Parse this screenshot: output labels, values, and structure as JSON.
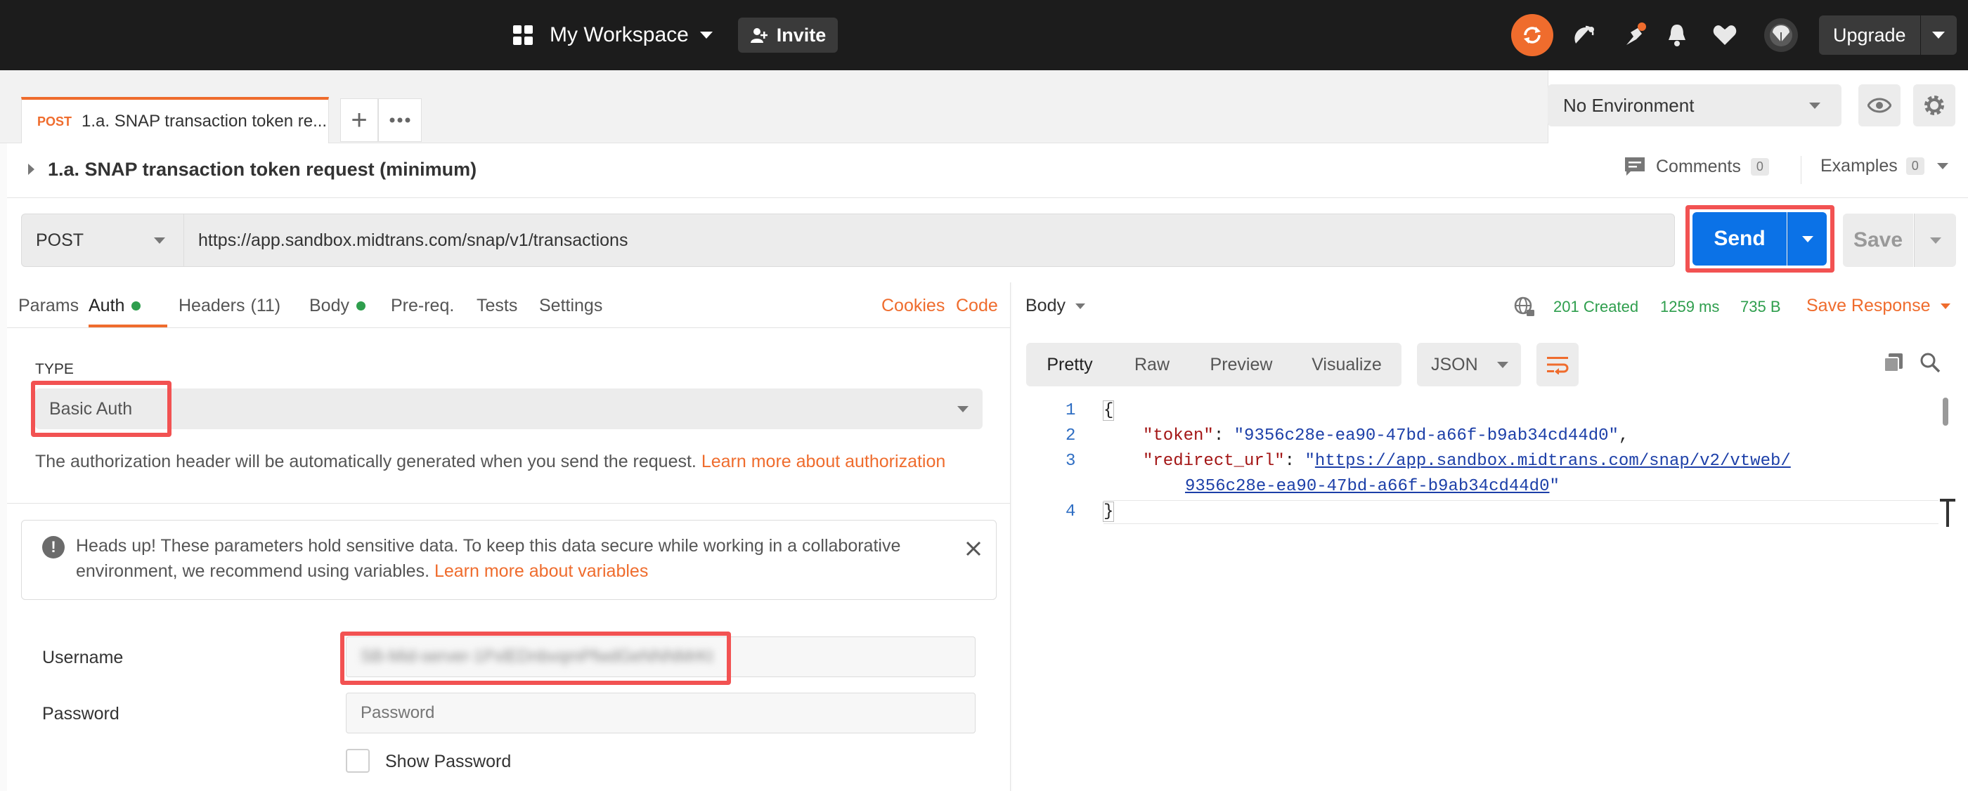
{
  "topbar": {
    "workspace_label": "My Workspace",
    "invite_label": "Invite",
    "upgrade_label": "Upgrade"
  },
  "tabs": {
    "active_method": "POST",
    "active_title": "1.a. SNAP transaction token re...",
    "environment": "No Environment"
  },
  "request": {
    "title": "1.a. SNAP transaction token request (minimum)",
    "comments_label": "Comments",
    "comments_count": "0",
    "examples_label": "Examples",
    "examples_count": "0",
    "method": "POST",
    "url": "https://app.sandbox.midtrans.com/snap/v1/transactions",
    "send_label": "Send",
    "save_label": "Save"
  },
  "req_tabs": {
    "params": "Params",
    "auth": "Auth",
    "headers": "Headers",
    "headers_count": "(11)",
    "body": "Body",
    "prereq": "Pre-req.",
    "tests": "Tests",
    "settings": "Settings",
    "cookies": "Cookies",
    "code": "Code"
  },
  "auth": {
    "type_label": "TYPE",
    "type_value": "Basic Auth",
    "description": "The authorization header will be automatically generated when you send the request.",
    "learn_more": "Learn more about authorization",
    "alert_text_1": "Heads up! These parameters hold sensitive data. To keep this data secure while working in a collaborative",
    "alert_text_2": "environment, we recommend using variables.",
    "alert_link": "Learn more about variables",
    "username_label": "Username",
    "username_value": "SB-Mid-server-1PxlEDnbvqmPfwdGeNNNMrKt",
    "password_label": "Password",
    "password_placeholder": "Password",
    "show_password": "Show Password"
  },
  "response": {
    "body_label": "Body",
    "status": "201 Created",
    "time": "1259 ms",
    "size": "735 B",
    "save_response": "Save Response",
    "view_tabs": [
      "Pretty",
      "Raw",
      "Preview",
      "Visualize"
    ],
    "format": "JSON",
    "line_numbers": [
      "1",
      "2",
      "3",
      "4"
    ],
    "open_brace": "{",
    "close_brace": "}",
    "token_key": "\"token\"",
    "token_value": "\"9356c28e-ea90-47bd-a66f-b9ab34cd44d0\"",
    "redirect_key": "\"redirect_url\"",
    "redirect_url_1": "https://app.sandbox.midtrans.com/snap/v2/vtweb/",
    "redirect_url_2": "9356c28e-ea90-47bd-a66f-b9ab34cd44d0"
  },
  "colors": {
    "accent_orange": "#ef6c2d",
    "send_blue": "#0b72e7",
    "highlight_red": "#f25252",
    "status_green": "#2e9e4d"
  }
}
